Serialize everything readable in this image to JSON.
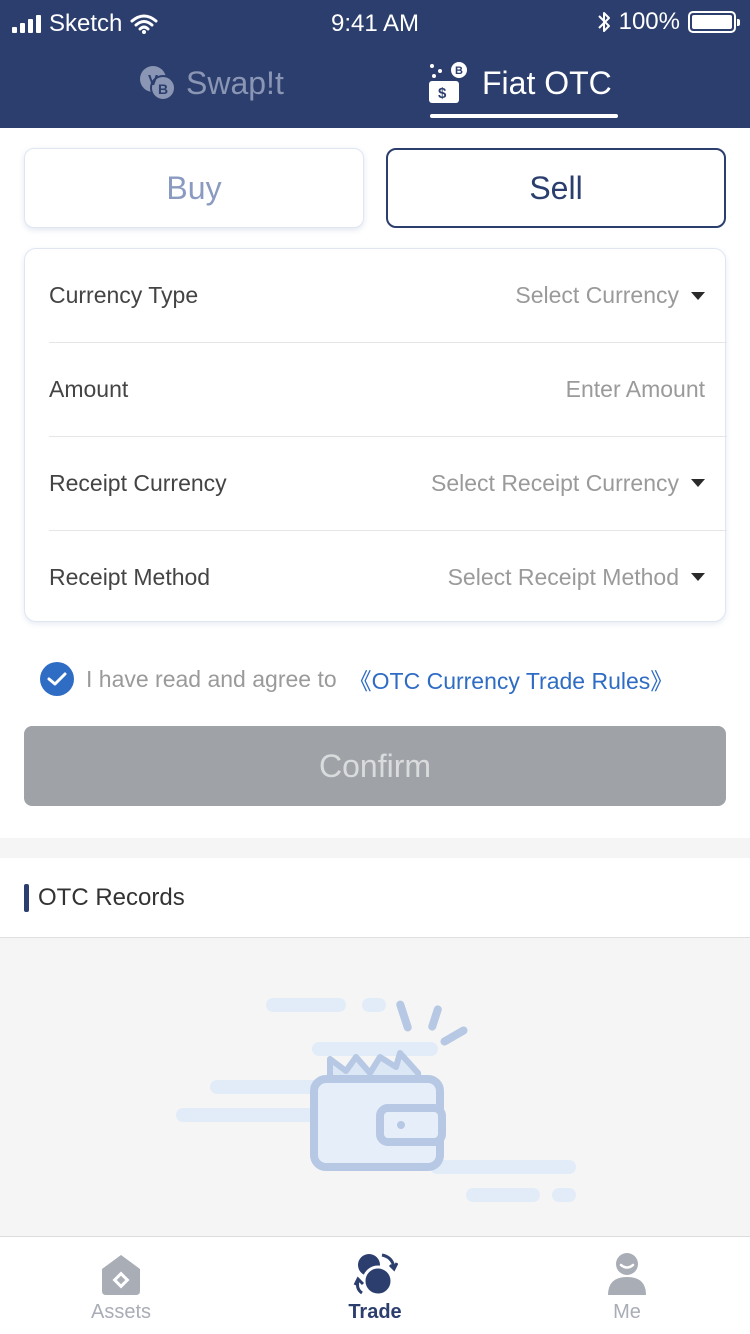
{
  "status_bar": {
    "carrier": "Sketch",
    "time": "9:41 AM",
    "battery": "100%"
  },
  "header": {
    "tabs": [
      {
        "label": "Swap!t",
        "active": false
      },
      {
        "label": "Fiat OTC",
        "active": true
      }
    ]
  },
  "segment": {
    "buy_label": "Buy",
    "sell_label": "Sell",
    "selected": "Sell"
  },
  "form": {
    "rows": [
      {
        "label": "Currency Type",
        "value": "Select Currency",
        "dropdown": true
      },
      {
        "label": "Amount",
        "value": "Enter Amount",
        "dropdown": false
      },
      {
        "label": "Receipt Currency",
        "value": "Select Receipt Currency",
        "dropdown": true
      },
      {
        "label": "Receipt Method",
        "value": "Select Receipt Method",
        "dropdown": true
      }
    ]
  },
  "agreement": {
    "checked": true,
    "text": "I have read and agree to",
    "link": "《OTC Currency Trade Rules》"
  },
  "confirm_label": "Confirm",
  "records": {
    "title": "OTC Records",
    "empty_icon": "empty-wallet-icon"
  },
  "tabbar": {
    "items": [
      {
        "label": "Assets",
        "icon": "assets-icon",
        "active": false
      },
      {
        "label": "Trade",
        "icon": "trade-icon",
        "active": true
      },
      {
        "label": "Me",
        "icon": "me-icon",
        "active": false
      }
    ]
  },
  "colors": {
    "header_bg": "#2c3e6e",
    "accent_blue": "#2f6cc4",
    "confirm_disabled": "#9fa3a8"
  }
}
